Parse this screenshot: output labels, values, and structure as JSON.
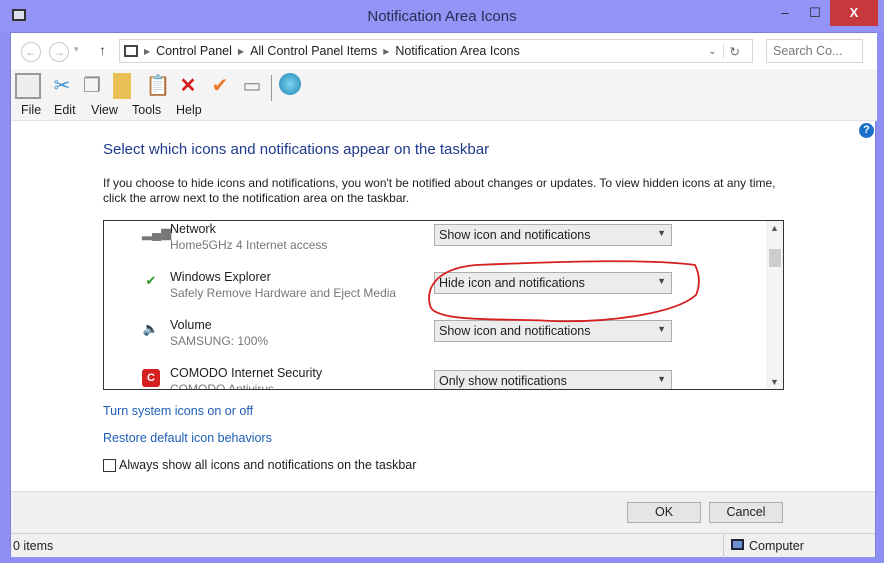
{
  "window": {
    "title": "Notification Area Icons",
    "minimize": "‒",
    "maximize": "☐",
    "close": "X"
  },
  "address": {
    "back": "←",
    "forward": "→",
    "dropdown": "▾",
    "up": "↑",
    "crumbs": [
      "Control Panel",
      "All Control Panel Items",
      "Notification Area Icons"
    ],
    "refresh": "↻",
    "search_placeholder": "Search Co..."
  },
  "menu": [
    "File",
    "Edit",
    "View",
    "Tools",
    "Help"
  ],
  "content": {
    "heading": "Select which icons and notifications appear on the taskbar",
    "description": "If you choose to hide icons and notifications, you won't be notified about changes or updates. To view hidden icons at any time, click the arrow next to the notification area on the taskbar.",
    "items": [
      {
        "name": "Network",
        "sub": "Home5GHz  4 Internet access",
        "behavior": "Show icon and notifications",
        "icon": "network-signal-icon"
      },
      {
        "name": "Windows Explorer",
        "sub": "Safely Remove Hardware and Eject Media",
        "behavior": "Hide icon and notifications",
        "icon": "usb-eject-icon"
      },
      {
        "name": "Volume",
        "sub": "SAMSUNG: 100%",
        "behavior": "Show icon and notifications",
        "icon": "speaker-icon"
      },
      {
        "name": "COMODO Internet Security",
        "sub": "COMODO Antivirus",
        "behavior": "Only show notifications",
        "icon": "comodo-icon"
      }
    ],
    "link_system_icons": "Turn system icons on or off",
    "link_restore": "Restore default icon behaviors",
    "always_show_label": "Always show all icons and notifications on the taskbar",
    "always_show_checked": false,
    "annotation_color": "#d42020"
  },
  "buttons": {
    "ok": "OK",
    "cancel": "Cancel"
  },
  "status": {
    "items": "0 items",
    "location": "Computer"
  }
}
